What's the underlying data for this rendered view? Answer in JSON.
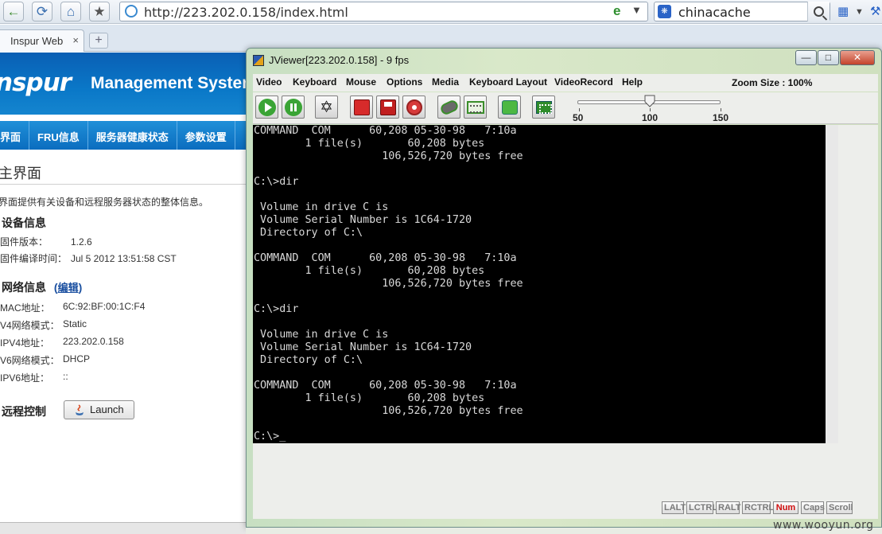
{
  "browser": {
    "url": "http://223.202.0.158/index.html",
    "search_query": "chinacache",
    "tab_title": "Inspur Web",
    "tab_close": "×",
    "new_tab": "+"
  },
  "page": {
    "logo": "nspur",
    "product_title": "Management System",
    "nav": [
      "界面",
      "FRU信息",
      "服务器健康状态",
      "参数设置"
    ],
    "title": "主界面",
    "description": "界面提供有关设备和远程服务器状态的整体信息。",
    "device_section": "设备信息",
    "device_info": [
      {
        "label": "固件版本：",
        "value": "1.2.6"
      },
      {
        "label": "固件编译时间：",
        "value": "Jul 5 2012 13:51:58 CST"
      }
    ],
    "network_section": "网络信息",
    "edit_link": "编辑",
    "edit_open": "(",
    "edit_close": ")",
    "network_info": [
      {
        "label": "MAC地址：",
        "value": "6C:92:BF:00:1C:F4"
      },
      {
        "label": "V4网络模式：",
        "value": "Static"
      },
      {
        "label": "IPV4地址：",
        "value": "223.202.0.158"
      },
      {
        "label": "V6网络模式：",
        "value": "DHCP"
      },
      {
        "label": "IPV6地址：",
        "value": "::"
      }
    ],
    "remote_section": "远程控制",
    "launch_label": "Launch"
  },
  "jviewer": {
    "title": "JViewer[223.202.0.158] - 9 fps",
    "menu": [
      "Video",
      "Keyboard",
      "Mouse",
      "Options",
      "Media",
      "Keyboard Layout",
      "VideoRecord",
      "Help"
    ],
    "zoom_label": "Zoom Size : 100%",
    "slider": {
      "min_label": "50",
      "mid_label": "100",
      "max_label": "150",
      "value": 100
    },
    "console_lines": [
      "COMMAND  COM      60,208 05-30-98   7:10a",
      "        1 file(s)       60,208 bytes",
      "                    106,526,720 bytes free",
      "",
      "C:\\>dir",
      "",
      " Volume in drive C is",
      " Volume Serial Number is 1C64-1720",
      " Directory of C:\\",
      "",
      "COMMAND  COM      60,208 05-30-98   7:10a",
      "        1 file(s)       60,208 bytes",
      "                    106,526,720 bytes free",
      "",
      "C:\\>dir",
      "",
      " Volume in drive C is",
      " Volume Serial Number is 1C64-1720",
      " Directory of C:\\",
      "",
      "COMMAND  COM      60,208 05-30-98   7:10a",
      "        1 file(s)       60,208 bytes",
      "                    106,526,720 bytes free",
      "",
      "C:\\>_"
    ],
    "status_keys": [
      {
        "label": "LALT",
        "active": false
      },
      {
        "label": "LCTRL",
        "active": false
      },
      {
        "label": "RALT",
        "active": false
      },
      {
        "label": "RCTRL",
        "active": false
      },
      {
        "label": "Num",
        "active": true
      },
      {
        "label": "Caps",
        "active": false
      },
      {
        "label": "Scroll",
        "active": false
      }
    ]
  },
  "watermark": "www.wooyun.org",
  "colors": {
    "header_blue": "#0a6fc0",
    "console_bg": "#000000",
    "num_active": "#d10f0f"
  }
}
